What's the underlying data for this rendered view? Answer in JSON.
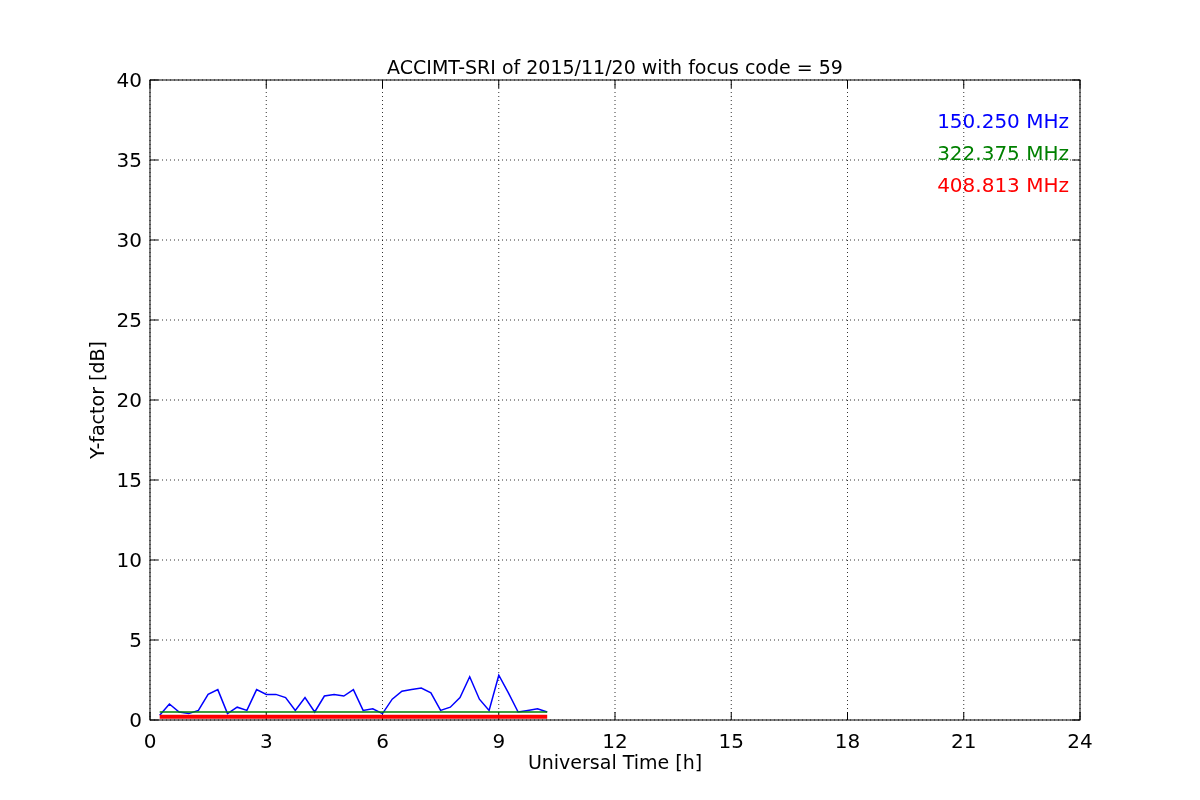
{
  "figure": {
    "chart_data": {
      "type": "line",
      "title": "ACCIMT-SRI of 2015/11/20 with focus code = 59",
      "xlabel": "Universal Time [h]",
      "ylabel": "Y-factor [dB]",
      "x": [
        0.25,
        0.5,
        0.75,
        1.0,
        1.25,
        1.5,
        1.75,
        2.0,
        2.25,
        2.5,
        2.75,
        3.0,
        3.25,
        3.5,
        3.75,
        4.0,
        4.25,
        4.5,
        4.75,
        5.0,
        5.25,
        5.5,
        5.75,
        6.0,
        6.25,
        6.5,
        6.75,
        7.0,
        7.25,
        7.5,
        7.75,
        8.0,
        8.25,
        8.5,
        8.75,
        9.0,
        9.25,
        9.5,
        9.75,
        10.0,
        10.25
      ],
      "series": [
        {
          "name": "150.250 MHz",
          "color": "#0000ff",
          "values": [
            0.3,
            1.0,
            0.5,
            0.4,
            0.6,
            1.6,
            1.9,
            0.4,
            0.8,
            0.6,
            1.9,
            1.6,
            1.6,
            1.4,
            0.6,
            1.4,
            0.5,
            1.5,
            1.6,
            1.5,
            1.9,
            0.6,
            0.7,
            0.4,
            1.3,
            1.8,
            1.9,
            2.0,
            1.7,
            0.6,
            0.8,
            1.4,
            2.7,
            1.3,
            0.6,
            2.8,
            1.7,
            0.5,
            0.6,
            0.7,
            0.5
          ]
        },
        {
          "name": "322.375 MHz",
          "color": "#008000",
          "values": [
            0.5,
            0.5,
            0.5,
            0.5,
            0.5,
            0.5,
            0.5,
            0.5,
            0.5,
            0.5,
            0.5,
            0.5,
            0.5,
            0.5,
            0.5,
            0.5,
            0.5,
            0.5,
            0.5,
            0.5,
            0.5,
            0.5,
            0.5,
            0.5,
            0.5,
            0.5,
            0.5,
            0.5,
            0.5,
            0.5,
            0.5,
            0.5,
            0.5,
            0.5,
            0.5,
            0.5,
            0.5,
            0.5,
            0.5,
            0.5,
            0.5
          ]
        },
        {
          "name": "408.813 MHz",
          "color": "#ff0000",
          "values": [
            0.2,
            0.2,
            0.2,
            0.2,
            0.2,
            0.2,
            0.2,
            0.2,
            0.2,
            0.2,
            0.2,
            0.2,
            0.2,
            0.2,
            0.2,
            0.2,
            0.2,
            0.2,
            0.2,
            0.2,
            0.2,
            0.2,
            0.2,
            0.2,
            0.2,
            0.2,
            0.2,
            0.2,
            0.2,
            0.2,
            0.2,
            0.2,
            0.2,
            0.2,
            0.2,
            0.2,
            0.2,
            0.2,
            0.2,
            0.2,
            0.2
          ]
        }
      ],
      "xlim": [
        0,
        24
      ],
      "ylim": [
        0,
        40
      ],
      "xticks": [
        0,
        3,
        6,
        9,
        12,
        15,
        18,
        21,
        24
      ],
      "yticks": [
        0,
        5,
        10,
        15,
        20,
        25,
        30,
        35,
        40
      ],
      "grid": true
    }
  }
}
